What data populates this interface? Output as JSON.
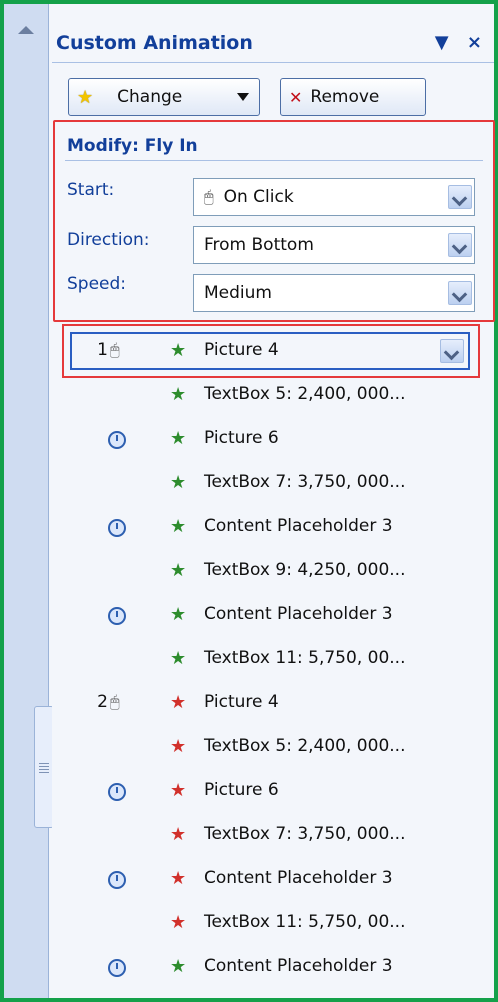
{
  "pane": {
    "title": "Custom Animation",
    "controls": {
      "dropdown": "▼",
      "close": "×"
    }
  },
  "toolbar": {
    "change_label": "Change",
    "remove_label": "Remove"
  },
  "modify": {
    "title": "Modify: Fly In",
    "start_label": "Start:",
    "start_value": "On Click",
    "direction_label": "Direction:",
    "direction_value": "From Bottom",
    "speed_label": "Speed:",
    "speed_value": "Medium"
  },
  "list": [
    {
      "num": "1",
      "trigger": "click",
      "effect": "green",
      "label": "Picture 4",
      "selected": true
    },
    {
      "num": "",
      "trigger": "",
      "effect": "green",
      "label": "TextBox 5: 2,400, 000..."
    },
    {
      "num": "",
      "trigger": "clock",
      "effect": "green",
      "label": "Picture 6"
    },
    {
      "num": "",
      "trigger": "",
      "effect": "green",
      "label": "TextBox 7: 3,750, 000..."
    },
    {
      "num": "",
      "trigger": "clock",
      "effect": "green",
      "label": "Content Placeholder 3"
    },
    {
      "num": "",
      "trigger": "",
      "effect": "green",
      "label": "TextBox 9: 4,250, 000..."
    },
    {
      "num": "",
      "trigger": "clock",
      "effect": "green",
      "label": "Content Placeholder 3"
    },
    {
      "num": "",
      "trigger": "",
      "effect": "green",
      "label": "TextBox 11: 5,750, 00..."
    },
    {
      "num": "2",
      "trigger": "click",
      "effect": "red",
      "label": "Picture 4"
    },
    {
      "num": "",
      "trigger": "",
      "effect": "red",
      "label": "TextBox 5: 2,400, 000..."
    },
    {
      "num": "",
      "trigger": "clock",
      "effect": "red",
      "label": "Picture 6"
    },
    {
      "num": "",
      "trigger": "",
      "effect": "red",
      "label": "TextBox 7: 3,750, 000..."
    },
    {
      "num": "",
      "trigger": "clock",
      "effect": "red",
      "label": "Content Placeholder 3"
    },
    {
      "num": "",
      "trigger": "",
      "effect": "red",
      "label": "TextBox 11: 5,750, 00..."
    },
    {
      "num": "",
      "trigger": "clock",
      "effect": "green",
      "label": "Content Placeholder 3"
    }
  ],
  "colors": {
    "frame": "#14a14a",
    "title": "#123f9a",
    "highlight": "#e5393b",
    "selection": "#2a5ec2"
  }
}
